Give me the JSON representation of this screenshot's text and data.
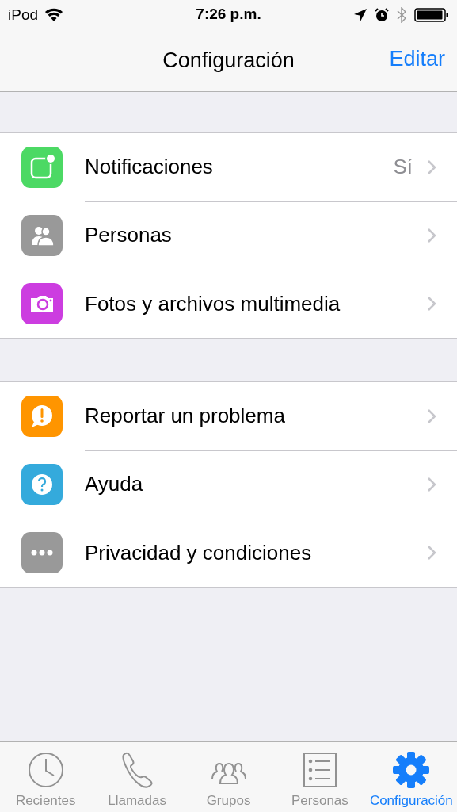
{
  "status_bar": {
    "carrier": "iPod",
    "time": "7:26 p.m."
  },
  "nav_bar": {
    "title": "Configuración",
    "action": "Editar"
  },
  "groups": [
    {
      "items": [
        {
          "label": "Notificaciones",
          "value": "Sí"
        },
        {
          "label": "Personas"
        },
        {
          "label": "Fotos y archivos multimedia"
        }
      ]
    },
    {
      "items": [
        {
          "label": "Reportar un problema"
        },
        {
          "label": "Ayuda"
        },
        {
          "label": "Privacidad y condiciones"
        }
      ]
    }
  ],
  "tab_bar": [
    {
      "label": "Recientes",
      "selected": false
    },
    {
      "label": "Llamadas",
      "selected": false
    },
    {
      "label": "Grupos",
      "selected": false
    },
    {
      "label": "Personas",
      "selected": false
    },
    {
      "label": "Configuración",
      "selected": true
    }
  ]
}
